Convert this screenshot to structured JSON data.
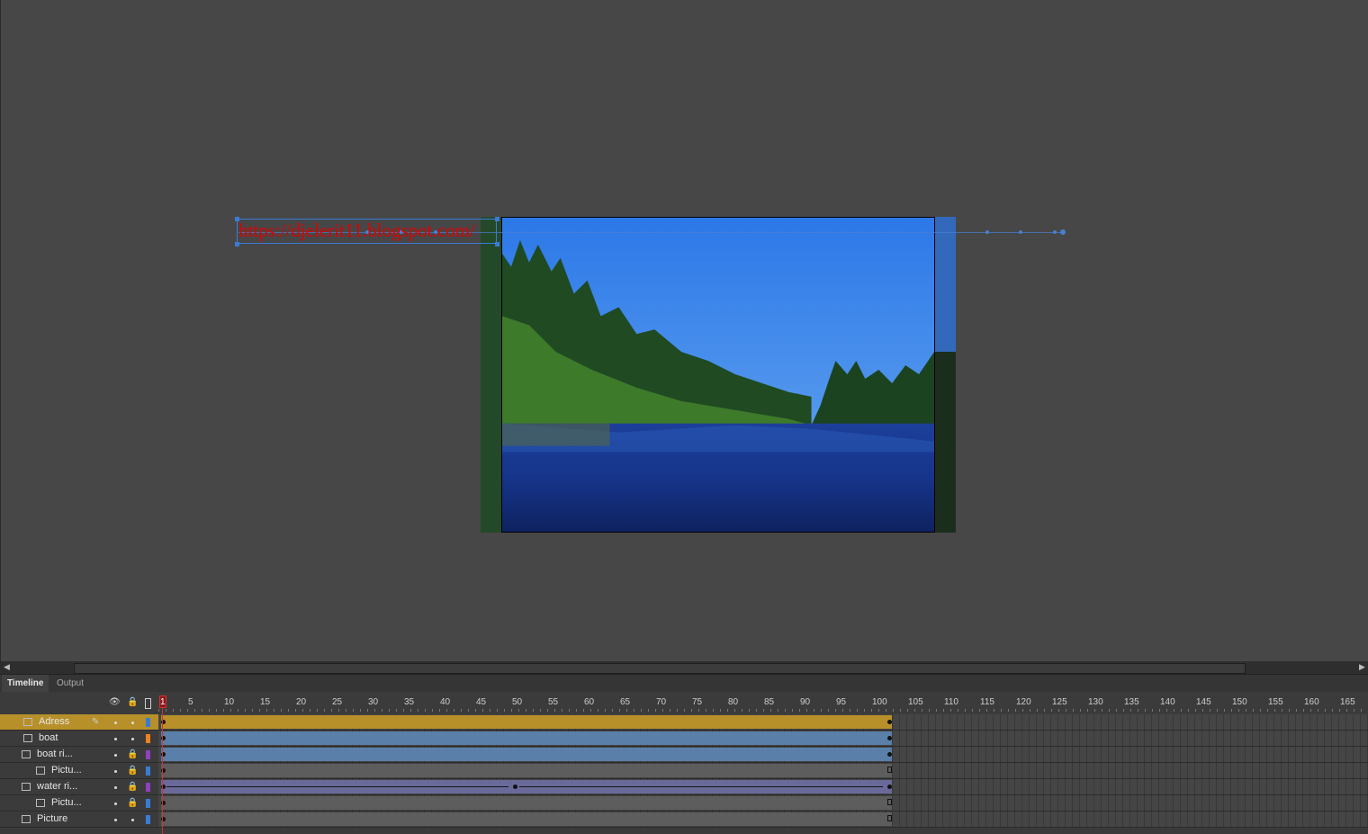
{
  "stage": {
    "url_text": "https://djelerit11.blogspot.com/"
  },
  "panel_tabs": [
    {
      "label": "Timeline",
      "active": true
    },
    {
      "label": "Output",
      "active": false
    }
  ],
  "timeline": {
    "current_frame": "1",
    "ruler_labels": [
      "5",
      "10",
      "15",
      "20",
      "25",
      "30",
      "35",
      "40",
      "45",
      "50",
      "55",
      "60",
      "65",
      "70",
      "75",
      "80",
      "85",
      "90",
      "95",
      "100",
      "105",
      "110",
      "115",
      "120",
      "125",
      "130",
      "135",
      "140",
      "145",
      "150",
      "155",
      "160",
      "165"
    ],
    "layers": [
      {
        "name": "Adress",
        "selected": true,
        "locked": false,
        "color": "#3a7bd5",
        "type": "guided"
      },
      {
        "name": "boat",
        "selected": false,
        "locked": false,
        "color": "#f08020",
        "type": "guided"
      },
      {
        "name": "boat ri...",
        "selected": false,
        "locked": true,
        "color": "#9040c0",
        "type": "mask"
      },
      {
        "name": "Pictu...",
        "selected": false,
        "locked": true,
        "color": "#3a7bd5",
        "type": "masked"
      },
      {
        "name": "water ri...",
        "selected": false,
        "locked": true,
        "color": "#9040c0",
        "type": "mask"
      },
      {
        "name": "Pictu...",
        "selected": false,
        "locked": true,
        "color": "#3a7bd5",
        "type": "masked"
      },
      {
        "name": "Picture",
        "selected": false,
        "locked": false,
        "color": "#3a7bd5",
        "type": "normal"
      }
    ]
  },
  "colors": {
    "selection": "#b8902a",
    "tween_blue": "#5a7fa8",
    "shape_tween": "#6a6a9a",
    "playhead": "#d03030"
  }
}
